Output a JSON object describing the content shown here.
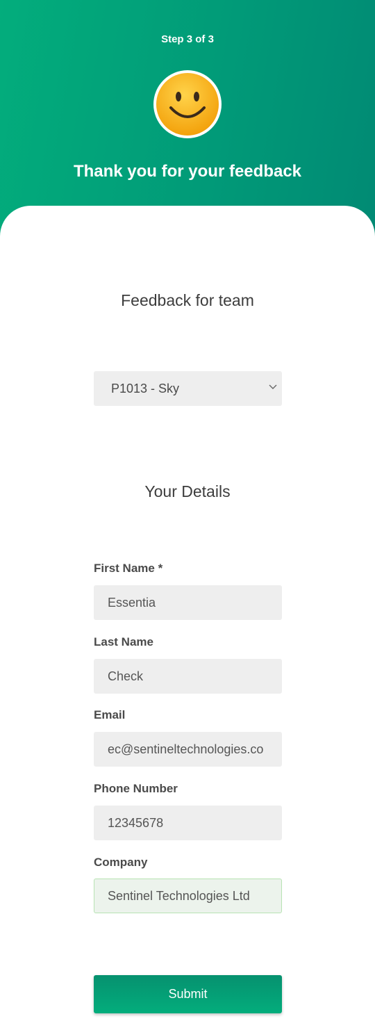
{
  "header": {
    "step_text": "Step 3 of 3",
    "title": "Thank you for your feedback",
    "emoji_icon": "smiley-face-icon"
  },
  "feedback": {
    "title": "Feedback for team",
    "team_select_value": "P1013 - Sky"
  },
  "details": {
    "title": "Your Details",
    "first_name_label": "First Name *",
    "first_name_value": "Essentia",
    "last_name_label": "Last Name",
    "last_name_value": "Check",
    "email_label": "Email",
    "email_value": "ec@sentineltechnologies.co",
    "phone_label": "Phone Number",
    "phone_value": "12345678",
    "company_label": "Company",
    "company_value": "Sentinel Technologies Ltd"
  },
  "submit_label": "Submit",
  "colors": {
    "brand_green": "#03ad7c",
    "brand_dark_green": "#018a74",
    "field_bg": "#eeeeee",
    "focus_border": "#b7e3b3"
  }
}
